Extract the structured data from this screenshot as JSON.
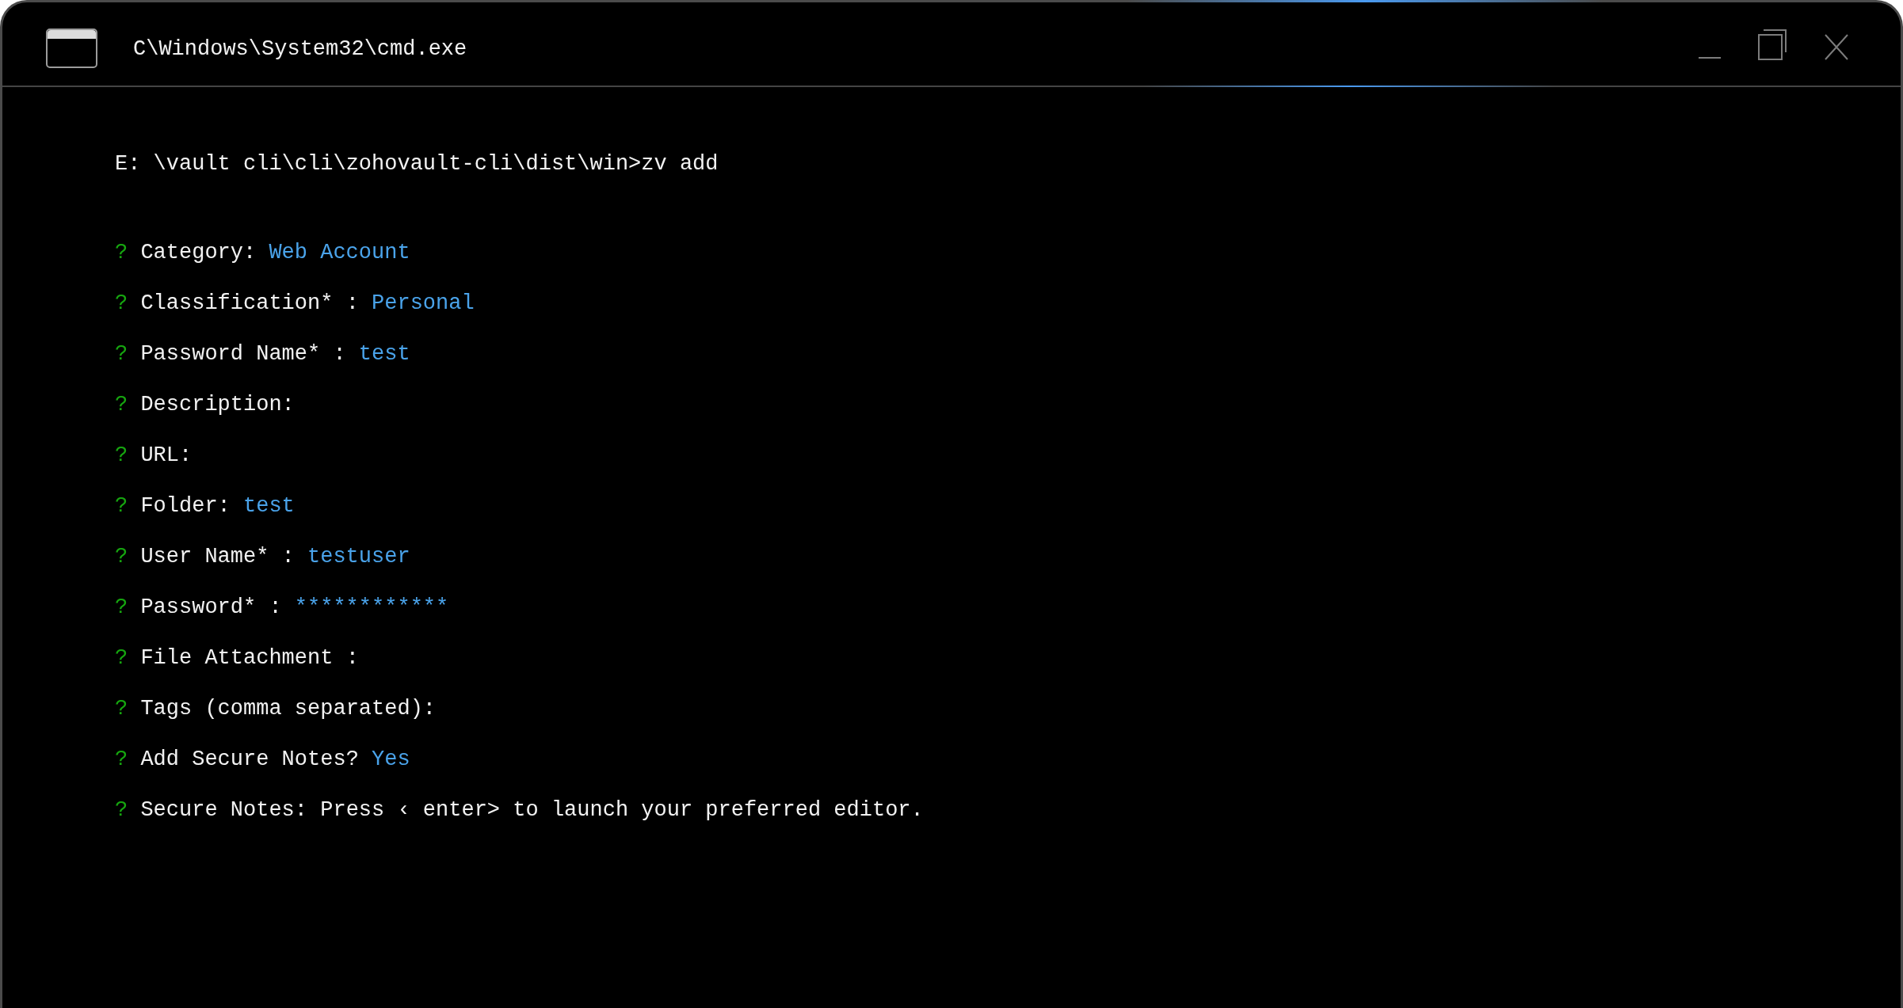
{
  "window": {
    "title": "C\\Windows\\System32\\cmd.exe"
  },
  "console": {
    "command": "E: \\vault cli\\cli\\zohovault-cli\\dist\\win>zv add",
    "prompts": [
      {
        "marker": "?",
        "label": "Category:",
        "value": "Web Account"
      },
      {
        "marker": "?",
        "label": "Classification* :",
        "value": "Personal"
      },
      {
        "marker": "?",
        "label": "Password Name* :",
        "value": "test"
      },
      {
        "marker": "?",
        "label": "Description:"
      },
      {
        "marker": "?",
        "label": "URL:"
      },
      {
        "marker": "?",
        "label": "Folder:",
        "value": "test"
      },
      {
        "marker": "?",
        "label": "User Name* :",
        "value": "testuser"
      },
      {
        "marker": "?",
        "label": "Password* :",
        "value": "************"
      },
      {
        "marker": "?",
        "label": "File Attachment :"
      },
      {
        "marker": "?",
        "label": "Tags (comma separated):"
      },
      {
        "marker": "?",
        "label": "Add Secure Notes?",
        "value": "Yes"
      },
      {
        "marker": "?",
        "label": "Secure Notes: Press ‹ enter> to launch your preferred editor."
      }
    ]
  }
}
